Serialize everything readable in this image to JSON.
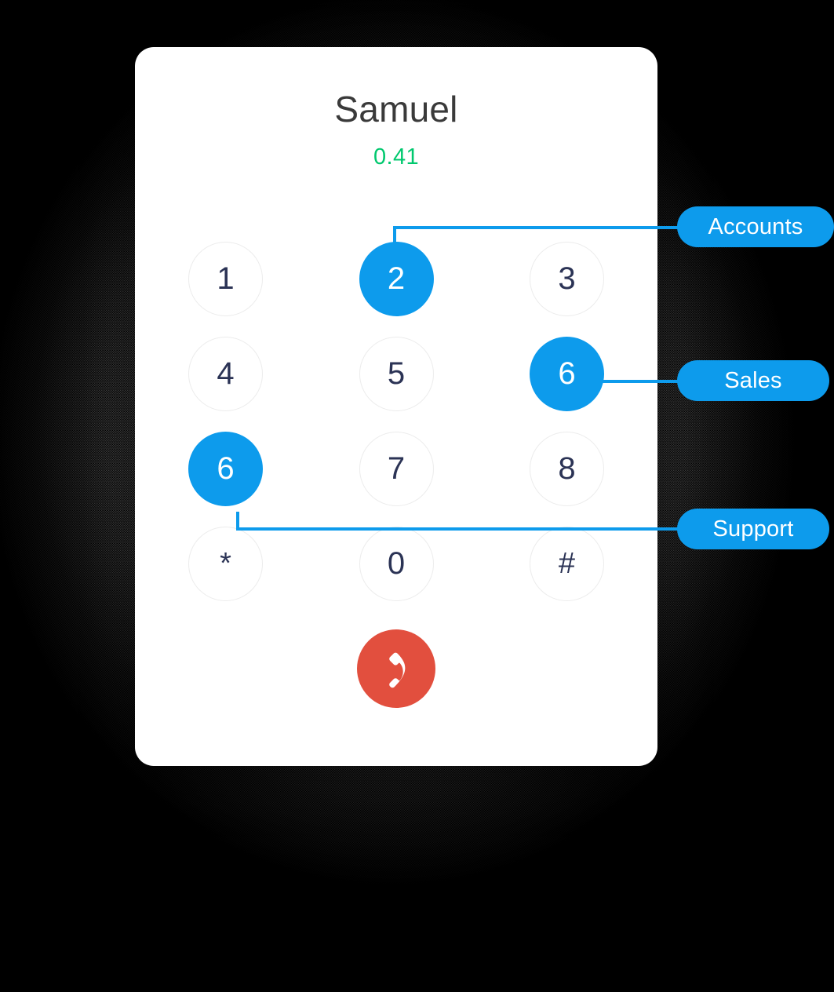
{
  "call": {
    "contact_name": "Samuel",
    "timer": "0.41",
    "timer_color": "#00c86e",
    "name_color": "#3a3a3a"
  },
  "theme": {
    "accent_blue": "#0d9bec",
    "hangup_red": "#e24f3e",
    "key_border": "#ececec",
    "key_text": "#2b3355",
    "card_bg": "#ffffff",
    "page_bg": "#000000"
  },
  "keypad": {
    "rows": [
      [
        {
          "label": "1",
          "highlighted": false
        },
        {
          "label": "2",
          "highlighted": true
        },
        {
          "label": "3",
          "highlighted": false
        }
      ],
      [
        {
          "label": "4",
          "highlighted": false
        },
        {
          "label": "5",
          "highlighted": false
        },
        {
          "label": "6",
          "highlighted": true
        }
      ],
      [
        {
          "label": "6",
          "highlighted": true
        },
        {
          "label": "7",
          "highlighted": false
        },
        {
          "label": "8",
          "highlighted": false
        }
      ],
      [
        {
          "label": "*",
          "highlighted": false
        },
        {
          "label": "0",
          "highlighted": false
        },
        {
          "label": "#",
          "highlighted": false
        }
      ]
    ]
  },
  "hangup_button": {
    "icon": "phone-hangup-icon",
    "color": "#e24f3e"
  },
  "callouts": [
    {
      "label": "Accounts",
      "target_key": "2"
    },
    {
      "label": "Sales",
      "target_key": "6"
    },
    {
      "label": "Support",
      "target_key": "6"
    }
  ]
}
